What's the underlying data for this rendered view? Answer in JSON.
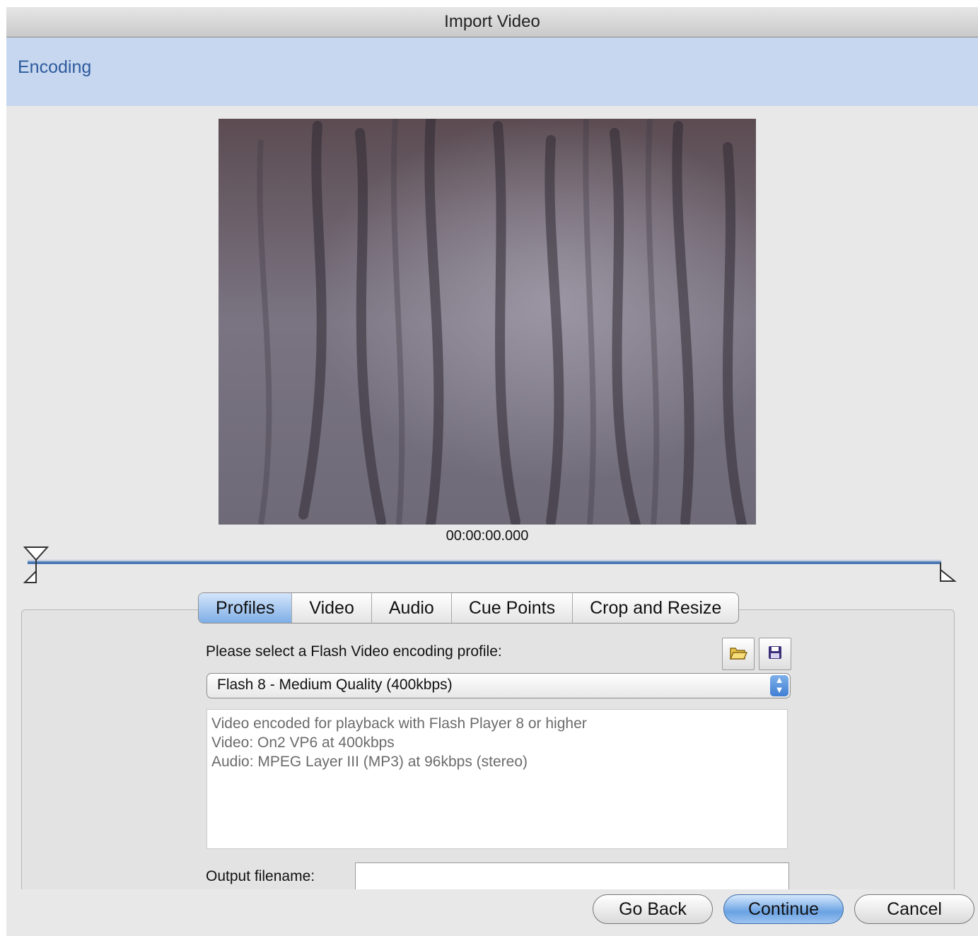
{
  "window": {
    "title": "Import Video"
  },
  "header": {
    "title": "Encoding"
  },
  "preview": {
    "timecode": "00:00:00.000"
  },
  "tabs": [
    {
      "label": "Profiles",
      "active": true
    },
    {
      "label": "Video",
      "active": false
    },
    {
      "label": "Audio",
      "active": false
    },
    {
      "label": "Cue Points",
      "active": false
    },
    {
      "label": "Crop and Resize",
      "active": false
    }
  ],
  "profiles": {
    "prompt": "Please select a Flash Video encoding profile:",
    "selected_profile": "Flash 8 - Medium Quality (400kbps)",
    "description": [
      "Video encoded for playback with Flash Player 8 or higher",
      "Video: On2 VP6 at 400kbps",
      "Audio: MPEG Layer III (MP3) at 96kbps (stereo)"
    ],
    "output_label": "Output filename:",
    "output_value": "",
    "icons": {
      "open": "folder-open-icon",
      "save": "save-disk-icon"
    }
  },
  "buttons": {
    "go_back": "Go Back",
    "continue": "Continue",
    "cancel": "Cancel"
  },
  "colors": {
    "header_band": "#c7d7ef",
    "header_text": "#2d5a9c",
    "timeline": "#4a79b5",
    "active_tab": "#7eaee6"
  }
}
